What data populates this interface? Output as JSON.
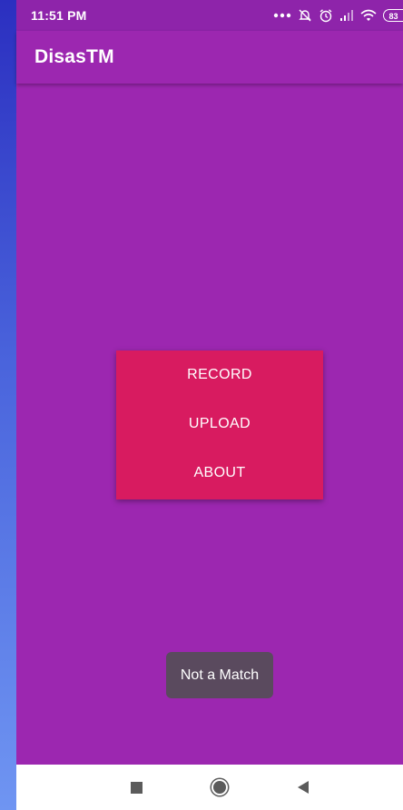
{
  "status_bar": {
    "time": "11:51 PM",
    "battery": "83",
    "icons": [
      "more-dots-icon",
      "mute-icon",
      "alarm-icon",
      "signal-icon",
      "wifi-icon",
      "battery-icon"
    ]
  },
  "app_bar": {
    "title": "DisasTM"
  },
  "menu": {
    "record_label": "RECORD",
    "upload_label": "UPLOAD",
    "about_label": "ABOUT"
  },
  "toast": {
    "message": "Not a Match"
  },
  "nav_bar": {
    "icons": [
      "recents-square-icon",
      "home-circle-icon",
      "back-triangle-icon"
    ]
  },
  "colors": {
    "primary": "#9c27b0",
    "status_bar": "#8e24aa",
    "accent": "#d81b60",
    "toast": "#5a4a5e",
    "nav_bar": "#ffffff"
  }
}
